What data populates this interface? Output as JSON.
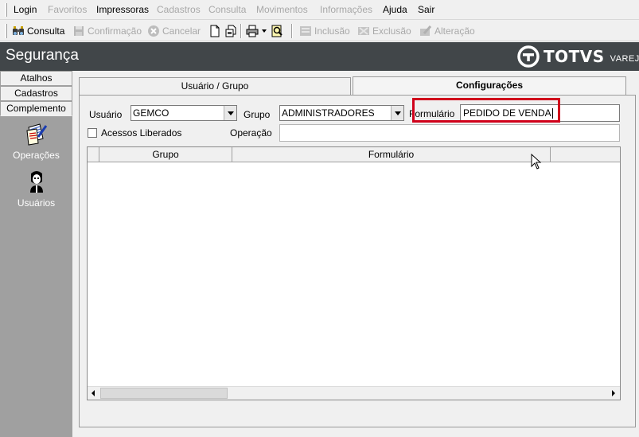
{
  "menu": {
    "items": [
      {
        "label": "Login",
        "enabled": true
      },
      {
        "label": "Favoritos",
        "enabled": false
      },
      {
        "label": "Impressoras",
        "enabled": true
      },
      {
        "label": "Cadastros",
        "enabled": false
      },
      {
        "label": "Consulta",
        "enabled": false
      },
      {
        "label": "Movimentos",
        "enabled": false
      },
      {
        "label": "Informações",
        "enabled": false
      },
      {
        "label": "Ajuda",
        "enabled": true
      },
      {
        "label": "Sair",
        "enabled": true
      }
    ]
  },
  "toolbar": {
    "consulta": "Consulta",
    "confirmacao": "Confirmação",
    "cancelar": "Cancelar",
    "inclusao": "Inclusão",
    "exclusao": "Exclusão",
    "alteracao": "Alteração"
  },
  "banner": {
    "title": "Segurança",
    "brand": "TOTVS",
    "sub": "VAREJO",
    "bg_color": "#414649"
  },
  "sidebar": {
    "tabs": [
      "Atalhos",
      "Cadastros",
      "Complemento"
    ],
    "active_tab": "Complemento",
    "items": [
      {
        "label": "Operações",
        "icon": "documents-icon"
      },
      {
        "label": "Usuários",
        "icon": "user-icon"
      }
    ]
  },
  "main": {
    "tabs": [
      {
        "label": "Usuário  / Grupo",
        "active": false
      },
      {
        "label": "Configurações",
        "active": true
      }
    ],
    "form": {
      "usuario_label": "Usuário",
      "usuario_value": "GEMCO",
      "grupo_label": "Grupo",
      "grupo_value": "ADMINISTRADORES",
      "formulario_label": "Formulário",
      "formulario_value": "PEDIDO DE VENDA",
      "acessos_label": "Acessos Liberados",
      "acessos_checked": false,
      "operacao_label": "Operação",
      "operacao_value": ""
    },
    "grid": {
      "columns": [
        "Grupo",
        "Formulário"
      ],
      "rows": []
    }
  },
  "colors": {
    "highlight": "#d0021b",
    "sidebar_bg": "#a0a0a0"
  }
}
